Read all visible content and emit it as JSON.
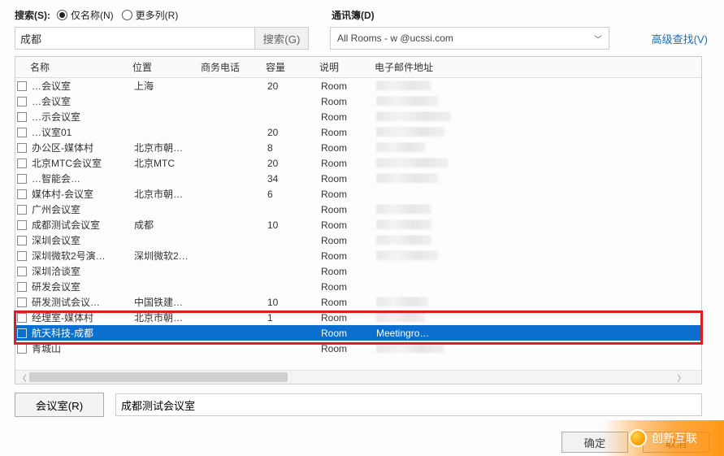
{
  "search": {
    "label": "搜索(S):",
    "radio_name_only": "仅名称(N)",
    "radio_more_cols": "更多列(R)",
    "value": "成都",
    "button": "搜索(G)"
  },
  "address_book": {
    "label": "通讯簿(D)",
    "value": "All Rooms - w        @ucssi.com"
  },
  "advanced_link": "高级查找(V)",
  "columns": {
    "name": "名称",
    "location": "位置",
    "phone": "商务电话",
    "capacity": "容量",
    "desc": "说明",
    "email": "电子邮件地址"
  },
  "rows": [
    {
      "name": "…会议室",
      "loc": "上海",
      "cap": "20",
      "desc": "Room",
      "email": "…ssi.c…"
    },
    {
      "name": "…会议室",
      "loc": "",
      "cap": "",
      "desc": "Room",
      "email": "…roo…  D…"
    },
    {
      "name": "…示会议室",
      "loc": "",
      "cap": "",
      "desc": "Room",
      "email": "s…     st01@…"
    },
    {
      "name": "…议室01",
      "loc": "",
      "cap": "20",
      "desc": "Room",
      "email": "…    ng01@…"
    },
    {
      "name": "办公区-媒体村",
      "loc": "北京市朝…",
      "cap": "8",
      "desc": "Room",
      "email": "…m-M…"
    },
    {
      "name": "北京MTC会议室",
      "loc": "北京MTC",
      "cap": "20",
      "desc": "Room",
      "email": "m-   …  om-…"
    },
    {
      "name": "…智能会…",
      "loc": "",
      "cap": "34",
      "desc": "Room",
      "email": "…   ng-r…"
    },
    {
      "name": "媒体村-会议室",
      "loc": "北京市朝…",
      "cap": "6",
      "desc": "Room",
      "email": ""
    },
    {
      "name": "广州会议室",
      "loc": "",
      "cap": "",
      "desc": "Room",
      "email": "M…  …n…"
    },
    {
      "name": "成都测试会议室",
      "loc": "成都",
      "cap": "10",
      "desc": "Room",
      "email": "…   …@…"
    },
    {
      "name": "深圳会议室",
      "loc": "",
      "cap": "",
      "desc": "Room",
      "email": "M…  …n…"
    },
    {
      "name": "深圳微软2号演…",
      "loc": "深圳微软2…",
      "cap": "",
      "desc": "Room",
      "email": "…   .02@…"
    },
    {
      "name": "深圳洽谈室",
      "loc": "",
      "cap": "",
      "desc": "Room",
      "email": ""
    },
    {
      "name": "研发会议室",
      "loc": "",
      "cap": "",
      "desc": "Room",
      "email": ""
    },
    {
      "name": "研发测试会议…",
      "loc": "中国铁建…",
      "cap": "10",
      "desc": "Room",
      "email": "m…   …"
    },
    {
      "name": "经理室-媒体村",
      "loc": "北京市朝…",
      "cap": "1",
      "desc": "Room",
      "email": "…   …"
    },
    {
      "name": "航天科技-成都",
      "loc": "",
      "cap": "",
      "desc": "Room",
      "email": "Meetingro…",
      "selected": true
    },
    {
      "name": "青城山",
      "loc": "",
      "cap": "",
      "desc": "Room",
      "email": "m…   … -qc…"
    }
  ],
  "bottom": {
    "room_button": "会议室(R)",
    "selected_value": "成都测试会议室"
  },
  "dialog": {
    "ok": "确定",
    "cancel": "取消"
  },
  "brand": "创新互联"
}
